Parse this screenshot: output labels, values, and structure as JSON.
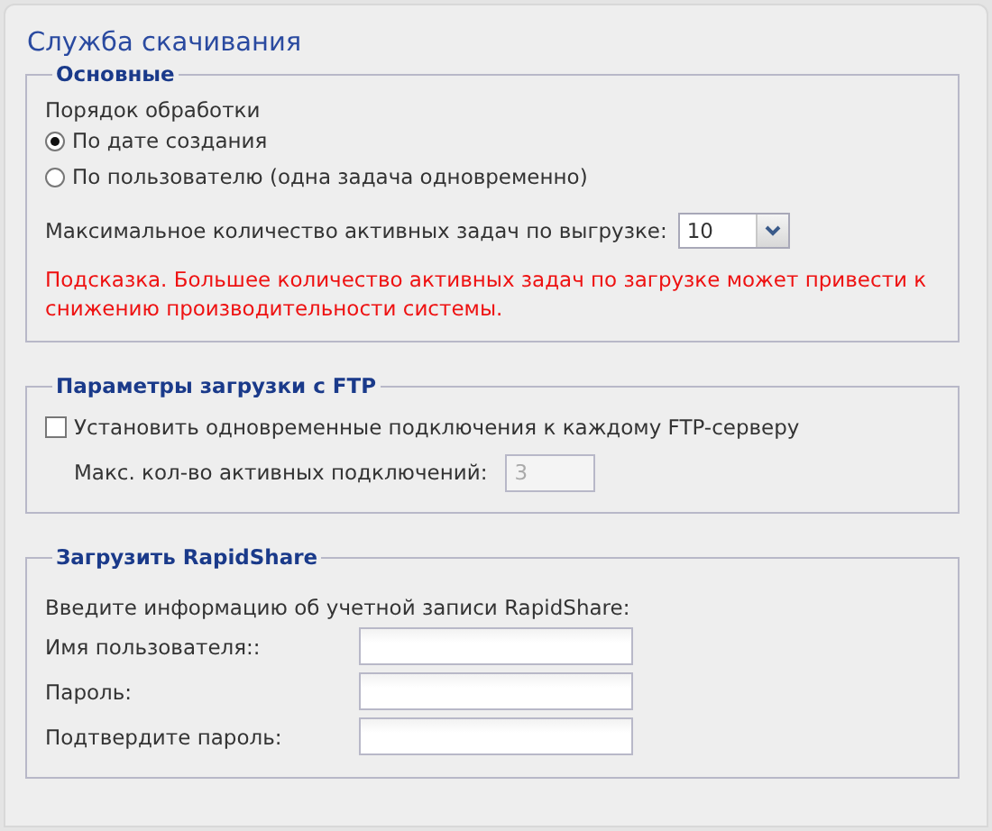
{
  "title": "Служба скачивания",
  "sections": [
    {
      "kind": "general",
      "legend": "Основные",
      "order_label": "Порядок обработки",
      "options": [
        {
          "label": "По дате создания",
          "selected": true
        },
        {
          "label": "По пользователю (одна задача одновременно)",
          "selected": false
        }
      ],
      "max_label": "Максимальное количество активных задач по выгрузке:",
      "max_value": "10",
      "hint": "Подсказка. Большее количество активных задач по загрузке может привести к снижению производительности системы."
    },
    {
      "kind": "ftp",
      "legend": "Параметры загрузки с FTP",
      "checkbox": {
        "label": "Установить одновременные подключения к каждому FTP-серверу",
        "checked": false
      },
      "conn_label": "Макс. кол-во активных подключений:",
      "conn_value": "3",
      "conn_disabled": true
    },
    {
      "kind": "rapidshare",
      "legend": "Загрузить RapidShare",
      "intro": "Введите информацию об учетной записи RapidShare:",
      "fields": [
        {
          "label": "Имя пользователя::"
        },
        {
          "label": "Пароль:"
        },
        {
          "label": "Подтвердите пароль:"
        }
      ]
    }
  ]
}
